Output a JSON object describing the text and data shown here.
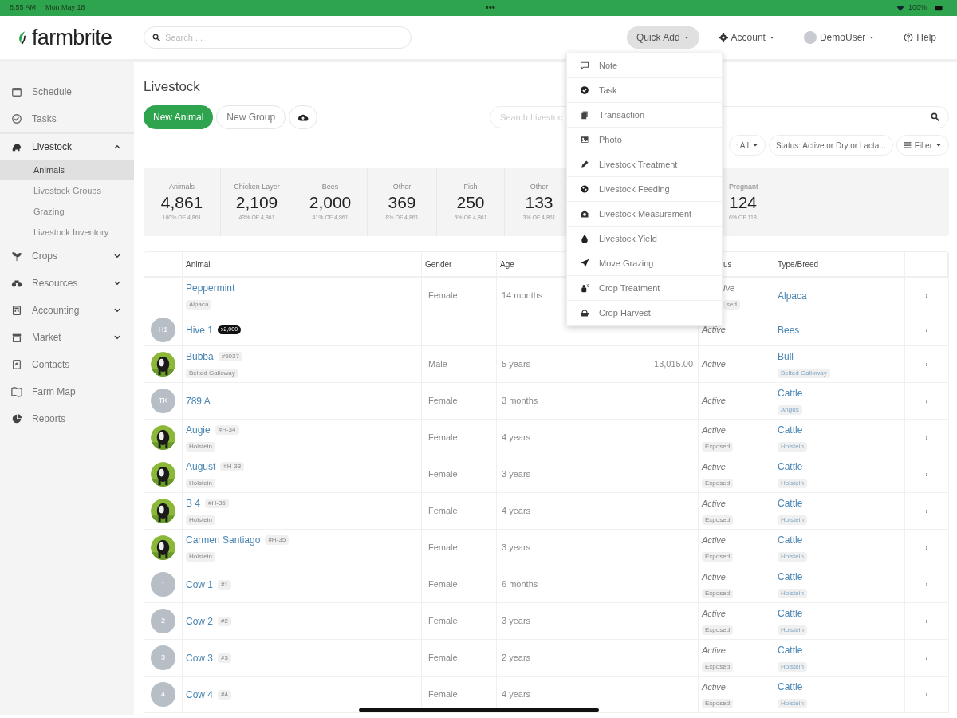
{
  "status_bar": {
    "time": "8:55 AM",
    "date": "Mon May 18",
    "dots": "•••",
    "battery": "100%"
  },
  "header": {
    "logo": "farmbrite",
    "search_placeholder": "Search ...",
    "menus": [
      {
        "kind": "quick",
        "label": "Quick Add",
        "selected": true
      },
      {
        "kind": "account",
        "label": "Account",
        "selected": false
      },
      {
        "kind": "user",
        "label": "DemoUser",
        "selected": false
      },
      {
        "kind": "help",
        "label": "Help",
        "selected": false
      }
    ]
  },
  "sidebar": {
    "items": [
      {
        "label": "Schedule",
        "selected": false
      },
      {
        "label": "Tasks",
        "selected": false
      },
      {
        "label": "Livestock",
        "selected": false,
        "expanded": true,
        "children": [
          {
            "label": "Animals",
            "selected": true
          },
          {
            "label": "Livestock Groups",
            "selected": false
          },
          {
            "label": "Grazing",
            "selected": false
          },
          {
            "label": "Livestock Inventory",
            "selected": false
          }
        ]
      },
      {
        "label": "Crops",
        "selected": false,
        "expanded": false
      },
      {
        "label": "Resources",
        "selected": false,
        "expanded": false
      },
      {
        "label": "Accounting",
        "selected": false,
        "expanded": false
      },
      {
        "label": "Market",
        "selected": false,
        "expanded": false
      },
      {
        "label": "Contacts",
        "selected": false
      },
      {
        "label": "Farm Map",
        "selected": false
      },
      {
        "label": "Reports",
        "selected": false
      }
    ]
  },
  "page": {
    "title": "Livestock",
    "buttons": [
      {
        "kind": "primary",
        "label": "New Animal"
      },
      {
        "kind": "secondary",
        "label": "New Group"
      },
      {
        "kind": "upload"
      }
    ],
    "search_placeholder": "Search Livestoc",
    "filters": [
      {
        "label": ": All"
      },
      {
        "label": "Status: Active or Dry or Lacta..."
      },
      {
        "label": "Filter",
        "kind": "filter"
      }
    ],
    "stats": [
      {
        "label": "Animals",
        "value": "4,861",
        "sub": "100% OF 4,861"
      },
      {
        "label": "Chicken Layer",
        "value": "2,109",
        "sub": "43% OF 4,861"
      },
      {
        "label": "Bees",
        "value": "2,000",
        "sub": "41% OF 4,861"
      },
      {
        "label": "Other",
        "value": "369",
        "sub": "8% OF 4,861"
      },
      {
        "label": "Fish",
        "value": "250",
        "sub": "5% OF 4,861"
      },
      {
        "label": "Other",
        "value": "133",
        "sub": "3% OF 4,861"
      },
      {
        "label": "Pregnant",
        "value": "124",
        "sub": "6% OF 118"
      }
    ]
  },
  "table": {
    "columns": [
      "",
      "Animal",
      "Gender",
      "Age",
      "",
      "us",
      "Type/Breed",
      ""
    ],
    "rows": [
      {
        "avatar": {
          "kind": "none"
        },
        "name": "Peppermint",
        "sub_tag": "Alpaca",
        "gender": "Female",
        "age": "14 months",
        "status": "ive",
        "status_tag": "sed",
        "type": "Alpaca"
      },
      {
        "avatar": {
          "kind": "initials",
          "text": "H1"
        },
        "name": "Hive 1",
        "count_badge": "x2,000",
        "status": "Active",
        "type": "Bees"
      },
      {
        "name": "Bubba",
        "tag": "#6037",
        "sub_tag": "Belted Galloway",
        "gender": "Male",
        "age": "5 years",
        "column_5": "13,015.00",
        "status": "Active",
        "type": "Bull",
        "breed": "Belted Galloway"
      },
      {
        "avatar": {
          "kind": "initials",
          "text": "TK"
        },
        "name": "789 A",
        "gender": "Female",
        "age": "3 months",
        "status": "Active",
        "type": "Cattle",
        "breed": "Angus"
      },
      {
        "name": "Augie",
        "tag": "#H-34",
        "sub_tag": "Holstein",
        "gender": "Female",
        "age": "4 years",
        "status": "Active",
        "status_tag": "Exposed",
        "type": "Cattle",
        "breed": "Holstein"
      },
      {
        "name": "August",
        "tag": "#H-33",
        "sub_tag": "Holstein",
        "gender": "Female",
        "age": "3 years",
        "status": "Active",
        "status_tag": "Exposed",
        "type": "Cattle",
        "breed": "Holstein"
      },
      {
        "name": "B 4",
        "tag": "#H-35",
        "sub_tag": "Holstein",
        "gender": "Female",
        "age": "4 years",
        "status": "Active",
        "status_tag": "Exposed",
        "type": "Cattle",
        "breed": "Holstein"
      },
      {
        "name": "Carmen Santiago",
        "tag": "#H-35",
        "sub_tag": "Holstein",
        "gender": "Female",
        "age": "3 years",
        "status": "Active",
        "status_tag": "Exposed",
        "type": "Cattle",
        "breed": "Holstein"
      },
      {
        "avatar": {
          "kind": "initials",
          "text": "1"
        },
        "name": "Cow 1",
        "tag": "#1",
        "gender": "Female",
        "age": "6 months",
        "status": "Active",
        "status_tag": "Exposed",
        "type": "Cattle",
        "breed": "Holstein"
      },
      {
        "avatar": {
          "kind": "initials",
          "text": "2"
        },
        "name": "Cow 2",
        "tag": "#2",
        "gender": "Female",
        "age": "3 years",
        "status": "Active",
        "status_tag": "Exposed",
        "type": "Cattle",
        "breed": "Holstein"
      },
      {
        "avatar": {
          "kind": "initials",
          "text": "3"
        },
        "name": "Cow 3",
        "tag": "#3",
        "gender": "Female",
        "age": "2 years",
        "status": "Active",
        "status_tag": "Exposed",
        "type": "Cattle",
        "breed": "Holstein"
      },
      {
        "avatar": {
          "kind": "initials",
          "text": "4"
        },
        "name": "Cow 4",
        "tag": "#4",
        "gender": "Female",
        "age": "4 years",
        "status": "Active",
        "status_tag": "Exposed",
        "type": "Cattle",
        "breed": "Holstein"
      }
    ]
  },
  "quick_add_menu": {
    "items": [
      {
        "label": "Note"
      },
      {
        "label": "Task"
      },
      {
        "label": "Transaction"
      },
      {
        "label": "Photo"
      },
      {
        "label": "Livestock Treatment"
      },
      {
        "label": "Livestock Feeding"
      },
      {
        "label": "Livestock Measurement"
      },
      {
        "label": "Livestock Yield"
      },
      {
        "label": "Move Grazing"
      },
      {
        "label": "Crop Treatment"
      },
      {
        "label": "Crop Harvest"
      }
    ]
  }
}
